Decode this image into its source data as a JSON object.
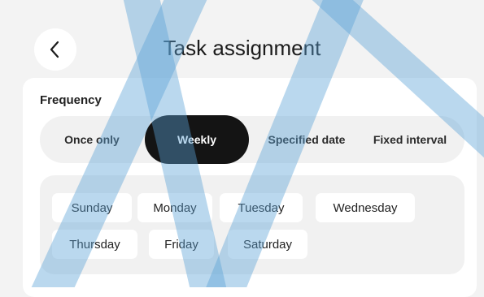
{
  "header": {
    "title": "Task assignment",
    "back_icon": "chevron-left-icon"
  },
  "frequency": {
    "label": "Frequency",
    "options": [
      "Once only",
      "Weekly",
      "Specified date",
      "Fixed interval"
    ],
    "selected": "Weekly"
  },
  "days": {
    "items": [
      "Sunday",
      "Monday",
      "Tuesday",
      "Wednesday",
      "Thursday",
      "Friday",
      "Saturday"
    ]
  },
  "colors": {
    "selected_bg": "#141414",
    "watermark": "#5aa3d6"
  }
}
